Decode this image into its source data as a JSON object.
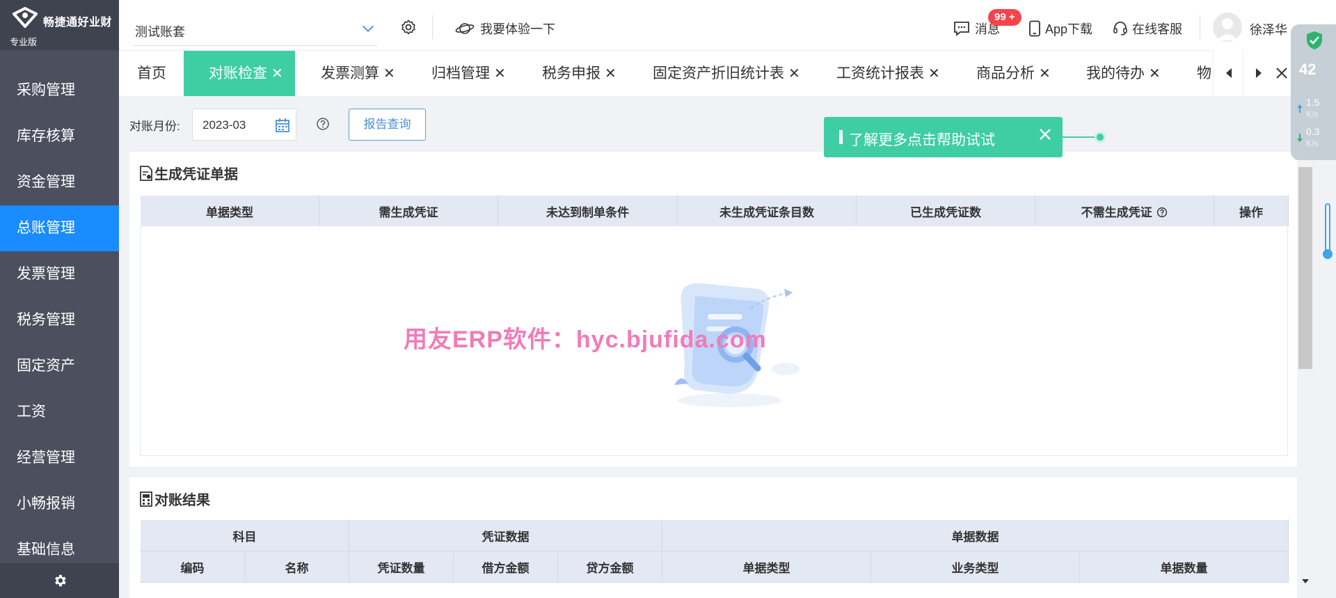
{
  "brand": {
    "name": "畅捷通好业财",
    "edition": "专业版"
  },
  "sidebar": {
    "items": [
      {
        "label": "采购管理"
      },
      {
        "label": "库存核算"
      },
      {
        "label": "资金管理"
      },
      {
        "label": "总账管理",
        "active": true
      },
      {
        "label": "发票管理"
      },
      {
        "label": "税务管理"
      },
      {
        "label": "固定资产"
      },
      {
        "label": "工资"
      },
      {
        "label": "经营管理"
      },
      {
        "label": "小畅报销"
      },
      {
        "label": "基础信息"
      }
    ]
  },
  "header": {
    "account": "测试账套",
    "experience": "我要体验一下",
    "messages": "消息",
    "badge": "99 +",
    "app_download": "App下载",
    "online_service": "在线客服",
    "username": "徐泽华"
  },
  "tabs": [
    {
      "label": "首页",
      "closable": false
    },
    {
      "label": "对账检查",
      "closable": true,
      "active": true
    },
    {
      "label": "发票测算",
      "closable": true
    },
    {
      "label": "归档管理",
      "closable": true
    },
    {
      "label": "税务申报",
      "closable": true
    },
    {
      "label": "固定资产折旧统计表",
      "closable": true
    },
    {
      "label": "工资统计报表",
      "closable": true
    },
    {
      "label": "商品分析",
      "closable": true
    },
    {
      "label": "我的待办",
      "closable": true
    },
    {
      "label": "物",
      "closable": false
    }
  ],
  "toolbar": {
    "month_label": "对账月份:",
    "month_value": "2023-03",
    "query_button": "报告查询"
  },
  "help_tip": {
    "text": "了解更多点击帮助试试"
  },
  "voucher_panel": {
    "title": "生成凭证单据",
    "columns": [
      "单据类型",
      "需生成凭证",
      "未达到制单条件",
      "未生成凭证条目数",
      "已生成凭证数",
      "不需生成凭证",
      "操作"
    ]
  },
  "result_panel": {
    "title": "对账结果",
    "group_headers": [
      "科目",
      "凭证数据",
      "单据数据"
    ],
    "columns": [
      "编码",
      "名称",
      "凭证数量",
      "借方金额",
      "贷方金额",
      "单据类型",
      "业务类型",
      "单据数量"
    ]
  },
  "watermark": "用友ERP软件：hyc.bjufida.com",
  "widget": {
    "value": "42",
    "up_speed": "1.5",
    "down_speed": "0.3",
    "unit": "K/s"
  },
  "colors": {
    "sidebar": "#4b4f5e",
    "active_nav": "#1a8cff",
    "accent": "#3fcea4",
    "badge": "#f5444b"
  }
}
